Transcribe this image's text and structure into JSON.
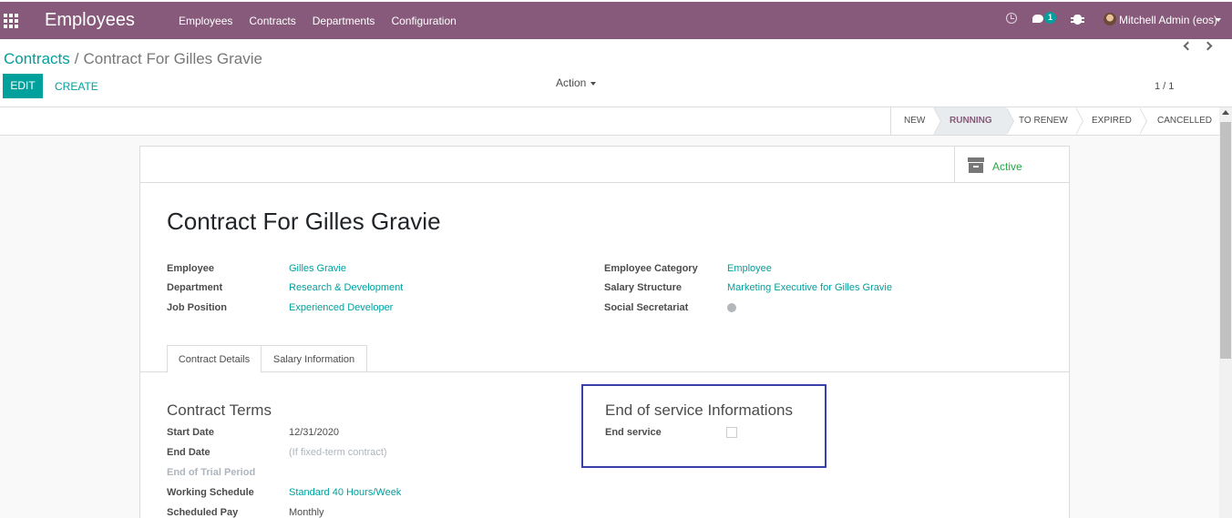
{
  "navbar": {
    "app_title": "Employees",
    "menu": [
      "Employees",
      "Contracts",
      "Departments",
      "Configuration"
    ],
    "chat_count": "1",
    "user": "Mitchell Admin (eos)",
    "brand_color": "#875a7b"
  },
  "control": {
    "breadcrumb_parent": "Contracts",
    "breadcrumb_sep": "/",
    "breadcrumb_current": "Contract For Gilles Gravie",
    "edit_label": "EDIT",
    "create_label": "CREATE",
    "action_label": "Action",
    "pager": "1 / 1"
  },
  "stages": [
    "NEW",
    "RUNNING",
    "TO RENEW",
    "EXPIRED",
    "CANCELLED"
  ],
  "active_stage": "RUNNING",
  "sheet": {
    "active_label": "Active",
    "title": "Contract For Gilles Gravie",
    "left_fields": [
      {
        "label": "Employee",
        "value": "Gilles Gravie"
      },
      {
        "label": "Department",
        "value": "Research & Development"
      },
      {
        "label": "Job Position",
        "value": "Experienced Developer"
      }
    ],
    "right_fields": [
      {
        "label": "Employee Category",
        "value": "Employee"
      },
      {
        "label": "Salary Structure",
        "value": "Marketing Executive for Gilles Gravie"
      },
      {
        "label": "Social Secretariat",
        "value": ""
      }
    ],
    "tabs": [
      "Contract Details",
      "Salary Information"
    ],
    "contract_terms_title": "Contract Terms",
    "contract_terms": [
      {
        "label": "Start Date",
        "value": "12/31/2020"
      },
      {
        "label": "End Date",
        "value": "(If fixed-term contract)"
      },
      {
        "label": "End of Trial Period",
        "value": ""
      },
      {
        "label": "Working Schedule",
        "value": "Standard 40 Hours/Week"
      },
      {
        "label": "Scheduled Pay",
        "value": "Monthly"
      }
    ],
    "end_service_title": "End of service Informations",
    "end_service_label": "End service"
  }
}
